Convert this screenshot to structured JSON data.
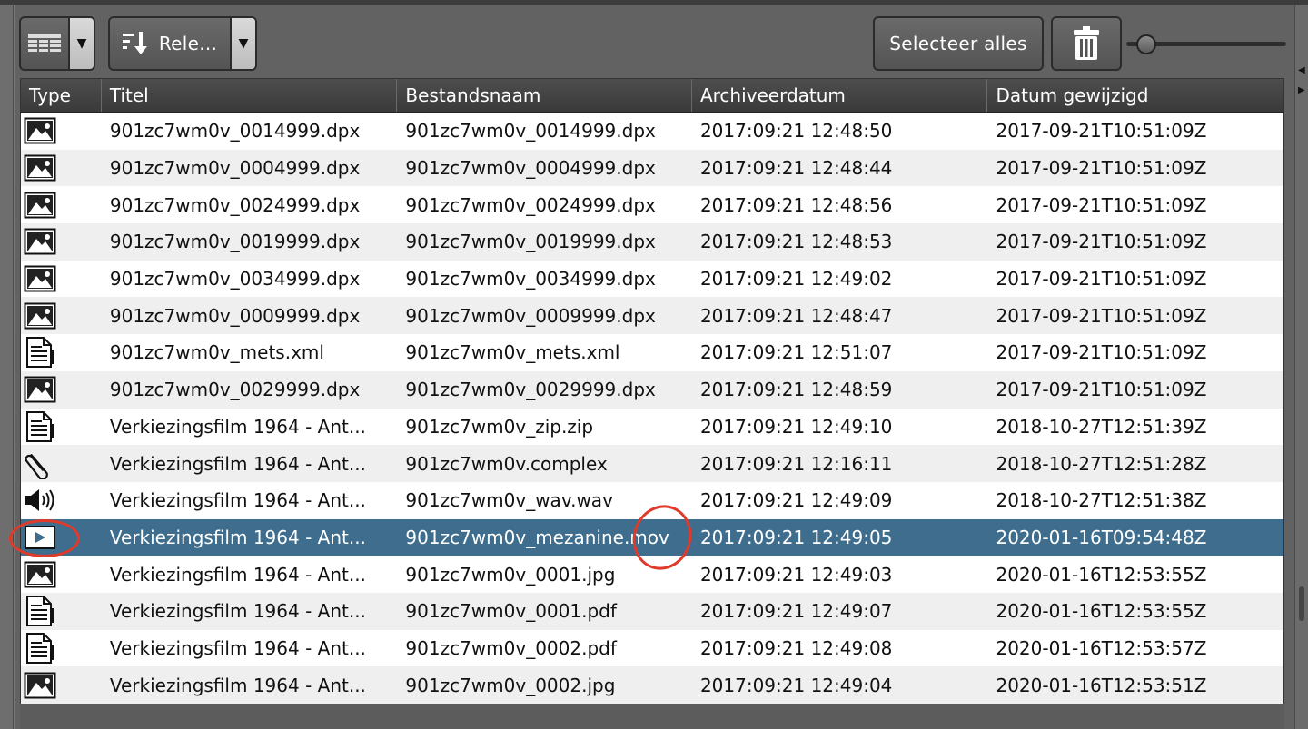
{
  "toolbar": {
    "sort_label": "Rele...",
    "select_all_label": "Selecteer alles",
    "view_arrow": "▼",
    "sort_arrow": "▼"
  },
  "table": {
    "headers": [
      "Type",
      "Titel",
      "Bestandsnaam",
      "Archiveerdatum",
      "Datum gewijzigd"
    ],
    "rows": [
      {
        "type_icon": "image-file-icon",
        "titel": "901zc7wm0v_0014999.dpx",
        "bestandsnaam": "901zc7wm0v_0014999.dpx",
        "archiveerdatum": "2017:09:21 12:48:50",
        "datum_gewijzigd": "2017-09-21T10:51:09Z"
      },
      {
        "type_icon": "image-file-icon",
        "titel": "901zc7wm0v_0004999.dpx",
        "bestandsnaam": "901zc7wm0v_0004999.dpx",
        "archiveerdatum": "2017:09:21 12:48:44",
        "datum_gewijzigd": "2017-09-21T10:51:09Z"
      },
      {
        "type_icon": "image-file-icon",
        "titel": "901zc7wm0v_0024999.dpx",
        "bestandsnaam": "901zc7wm0v_0024999.dpx",
        "archiveerdatum": "2017:09:21 12:48:56",
        "datum_gewijzigd": "2017-09-21T10:51:09Z"
      },
      {
        "type_icon": "image-file-icon",
        "titel": "901zc7wm0v_0019999.dpx",
        "bestandsnaam": "901zc7wm0v_0019999.dpx",
        "archiveerdatum": "2017:09:21 12:48:53",
        "datum_gewijzigd": "2017-09-21T10:51:09Z"
      },
      {
        "type_icon": "image-file-icon",
        "titel": "901zc7wm0v_0034999.dpx",
        "bestandsnaam": "901zc7wm0v_0034999.dpx",
        "archiveerdatum": "2017:09:21 12:49:02",
        "datum_gewijzigd": "2017-09-21T10:51:09Z"
      },
      {
        "type_icon": "image-file-icon",
        "titel": "901zc7wm0v_0009999.dpx",
        "bestandsnaam": "901zc7wm0v_0009999.dpx",
        "archiveerdatum": "2017:09:21 12:48:47",
        "datum_gewijzigd": "2017-09-21T10:51:09Z"
      },
      {
        "type_icon": "document-file-icon",
        "titel": "901zc7wm0v_mets.xml",
        "bestandsnaam": "901zc7wm0v_mets.xml",
        "archiveerdatum": "2017:09:21 12:51:07",
        "datum_gewijzigd": "2017-09-21T10:51:09Z"
      },
      {
        "type_icon": "image-file-icon",
        "titel": "901zc7wm0v_0029999.dpx",
        "bestandsnaam": "901zc7wm0v_0029999.dpx",
        "archiveerdatum": "2017:09:21 12:48:59",
        "datum_gewijzigd": "2017-09-21T10:51:09Z"
      },
      {
        "type_icon": "document-file-icon",
        "titel": "Verkiezingsfilm 1964 - Ant...",
        "bestandsnaam": "901zc7wm0v_zip.zip",
        "archiveerdatum": "2017:09:21 12:49:10",
        "datum_gewijzigd": "2018-10-27T12:51:39Z"
      },
      {
        "type_icon": "paperclip-icon",
        "titel": "Verkiezingsfilm 1964 - Ant...",
        "bestandsnaam": "901zc7wm0v.complex",
        "archiveerdatum": "2017:09:21 12:16:11",
        "datum_gewijzigd": "2018-10-27T12:51:28Z"
      },
      {
        "type_icon": "audio-speaker-icon",
        "titel": "Verkiezingsfilm 1964 - Ant...",
        "bestandsnaam": "901zc7wm0v_wav.wav",
        "archiveerdatum": "2017:09:21 12:49:09",
        "datum_gewijzigd": "2018-10-27T12:51:38Z"
      },
      {
        "type_icon": "video-play-icon",
        "titel": "Verkiezingsfilm 1964 - Ant...",
        "bestandsnaam": "901zc7wm0v_mezanine.mov",
        "archiveerdatum": "2017:09:21 12:49:05",
        "datum_gewijzigd": "2020-01-16T09:54:48Z",
        "selected": true
      },
      {
        "type_icon": "image-file-icon",
        "titel": "Verkiezingsfilm 1964 - Ant...",
        "bestandsnaam": "901zc7wm0v_0001.jpg",
        "archiveerdatum": "2017:09:21 12:49:03",
        "datum_gewijzigd": "2020-01-16T12:53:55Z"
      },
      {
        "type_icon": "document-file-icon",
        "titel": "Verkiezingsfilm 1964 - Ant...",
        "bestandsnaam": "901zc7wm0v_0001.pdf",
        "archiveerdatum": "2017:09:21 12:49:07",
        "datum_gewijzigd": "2020-01-16T12:53:55Z"
      },
      {
        "type_icon": "document-file-icon",
        "titel": "Verkiezingsfilm 1964 - Ant...",
        "bestandsnaam": "901zc7wm0v_0002.pdf",
        "archiveerdatum": "2017:09:21 12:49:08",
        "datum_gewijzigd": "2020-01-16T12:53:57Z"
      },
      {
        "type_icon": "image-file-icon",
        "titel": "Verkiezingsfilm 1964 - Ant...",
        "bestandsnaam": "901zc7wm0v_0002.jpg",
        "archiveerdatum": "2017:09:21 12:49:04",
        "datum_gewijzigd": "2020-01-16T12:53:51Z"
      }
    ]
  },
  "colors": {
    "selected_row": "#3e6d8e",
    "annotation": "#e03a2a"
  }
}
